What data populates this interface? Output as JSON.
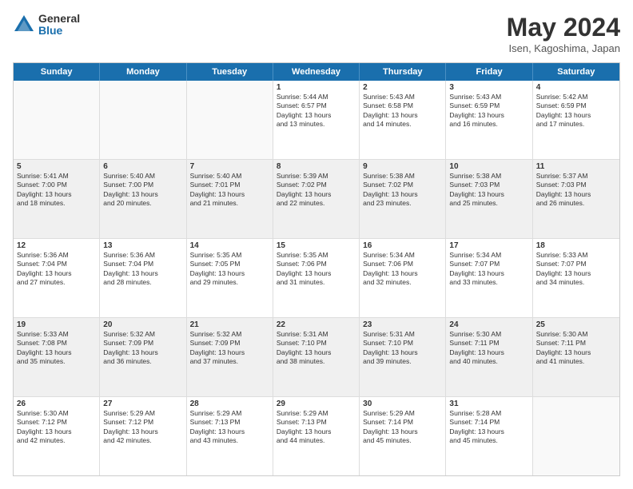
{
  "logo": {
    "general": "General",
    "blue": "Blue"
  },
  "title": "May 2024",
  "subtitle": "Isen, Kagoshima, Japan",
  "weekdays": [
    "Sunday",
    "Monday",
    "Tuesday",
    "Wednesday",
    "Thursday",
    "Friday",
    "Saturday"
  ],
  "rows": [
    [
      {
        "day": "",
        "lines": []
      },
      {
        "day": "",
        "lines": []
      },
      {
        "day": "",
        "lines": []
      },
      {
        "day": "1",
        "lines": [
          "Sunrise: 5:44 AM",
          "Sunset: 6:57 PM",
          "Daylight: 13 hours",
          "and 13 minutes."
        ]
      },
      {
        "day": "2",
        "lines": [
          "Sunrise: 5:43 AM",
          "Sunset: 6:58 PM",
          "Daylight: 13 hours",
          "and 14 minutes."
        ]
      },
      {
        "day": "3",
        "lines": [
          "Sunrise: 5:43 AM",
          "Sunset: 6:59 PM",
          "Daylight: 13 hours",
          "and 16 minutes."
        ]
      },
      {
        "day": "4",
        "lines": [
          "Sunrise: 5:42 AM",
          "Sunset: 6:59 PM",
          "Daylight: 13 hours",
          "and 17 minutes."
        ]
      }
    ],
    [
      {
        "day": "5",
        "lines": [
          "Sunrise: 5:41 AM",
          "Sunset: 7:00 PM",
          "Daylight: 13 hours",
          "and 18 minutes."
        ]
      },
      {
        "day": "6",
        "lines": [
          "Sunrise: 5:40 AM",
          "Sunset: 7:00 PM",
          "Daylight: 13 hours",
          "and 20 minutes."
        ]
      },
      {
        "day": "7",
        "lines": [
          "Sunrise: 5:40 AM",
          "Sunset: 7:01 PM",
          "Daylight: 13 hours",
          "and 21 minutes."
        ]
      },
      {
        "day": "8",
        "lines": [
          "Sunrise: 5:39 AM",
          "Sunset: 7:02 PM",
          "Daylight: 13 hours",
          "and 22 minutes."
        ]
      },
      {
        "day": "9",
        "lines": [
          "Sunrise: 5:38 AM",
          "Sunset: 7:02 PM",
          "Daylight: 13 hours",
          "and 23 minutes."
        ]
      },
      {
        "day": "10",
        "lines": [
          "Sunrise: 5:38 AM",
          "Sunset: 7:03 PM",
          "Daylight: 13 hours",
          "and 25 minutes."
        ]
      },
      {
        "day": "11",
        "lines": [
          "Sunrise: 5:37 AM",
          "Sunset: 7:03 PM",
          "Daylight: 13 hours",
          "and 26 minutes."
        ]
      }
    ],
    [
      {
        "day": "12",
        "lines": [
          "Sunrise: 5:36 AM",
          "Sunset: 7:04 PM",
          "Daylight: 13 hours",
          "and 27 minutes."
        ]
      },
      {
        "day": "13",
        "lines": [
          "Sunrise: 5:36 AM",
          "Sunset: 7:04 PM",
          "Daylight: 13 hours",
          "and 28 minutes."
        ]
      },
      {
        "day": "14",
        "lines": [
          "Sunrise: 5:35 AM",
          "Sunset: 7:05 PM",
          "Daylight: 13 hours",
          "and 29 minutes."
        ]
      },
      {
        "day": "15",
        "lines": [
          "Sunrise: 5:35 AM",
          "Sunset: 7:06 PM",
          "Daylight: 13 hours",
          "and 31 minutes."
        ]
      },
      {
        "day": "16",
        "lines": [
          "Sunrise: 5:34 AM",
          "Sunset: 7:06 PM",
          "Daylight: 13 hours",
          "and 32 minutes."
        ]
      },
      {
        "day": "17",
        "lines": [
          "Sunrise: 5:34 AM",
          "Sunset: 7:07 PM",
          "Daylight: 13 hours",
          "and 33 minutes."
        ]
      },
      {
        "day": "18",
        "lines": [
          "Sunrise: 5:33 AM",
          "Sunset: 7:07 PM",
          "Daylight: 13 hours",
          "and 34 minutes."
        ]
      }
    ],
    [
      {
        "day": "19",
        "lines": [
          "Sunrise: 5:33 AM",
          "Sunset: 7:08 PM",
          "Daylight: 13 hours",
          "and 35 minutes."
        ]
      },
      {
        "day": "20",
        "lines": [
          "Sunrise: 5:32 AM",
          "Sunset: 7:09 PM",
          "Daylight: 13 hours",
          "and 36 minutes."
        ]
      },
      {
        "day": "21",
        "lines": [
          "Sunrise: 5:32 AM",
          "Sunset: 7:09 PM",
          "Daylight: 13 hours",
          "and 37 minutes."
        ]
      },
      {
        "day": "22",
        "lines": [
          "Sunrise: 5:31 AM",
          "Sunset: 7:10 PM",
          "Daylight: 13 hours",
          "and 38 minutes."
        ]
      },
      {
        "day": "23",
        "lines": [
          "Sunrise: 5:31 AM",
          "Sunset: 7:10 PM",
          "Daylight: 13 hours",
          "and 39 minutes."
        ]
      },
      {
        "day": "24",
        "lines": [
          "Sunrise: 5:30 AM",
          "Sunset: 7:11 PM",
          "Daylight: 13 hours",
          "and 40 minutes."
        ]
      },
      {
        "day": "25",
        "lines": [
          "Sunrise: 5:30 AM",
          "Sunset: 7:11 PM",
          "Daylight: 13 hours",
          "and 41 minutes."
        ]
      }
    ],
    [
      {
        "day": "26",
        "lines": [
          "Sunrise: 5:30 AM",
          "Sunset: 7:12 PM",
          "Daylight: 13 hours",
          "and 42 minutes."
        ]
      },
      {
        "day": "27",
        "lines": [
          "Sunrise: 5:29 AM",
          "Sunset: 7:12 PM",
          "Daylight: 13 hours",
          "and 42 minutes."
        ]
      },
      {
        "day": "28",
        "lines": [
          "Sunrise: 5:29 AM",
          "Sunset: 7:13 PM",
          "Daylight: 13 hours",
          "and 43 minutes."
        ]
      },
      {
        "day": "29",
        "lines": [
          "Sunrise: 5:29 AM",
          "Sunset: 7:13 PM",
          "Daylight: 13 hours",
          "and 44 minutes."
        ]
      },
      {
        "day": "30",
        "lines": [
          "Sunrise: 5:29 AM",
          "Sunset: 7:14 PM",
          "Daylight: 13 hours",
          "and 45 minutes."
        ]
      },
      {
        "day": "31",
        "lines": [
          "Sunrise: 5:28 AM",
          "Sunset: 7:14 PM",
          "Daylight: 13 hours",
          "and 45 minutes."
        ]
      },
      {
        "day": "",
        "lines": []
      }
    ]
  ]
}
